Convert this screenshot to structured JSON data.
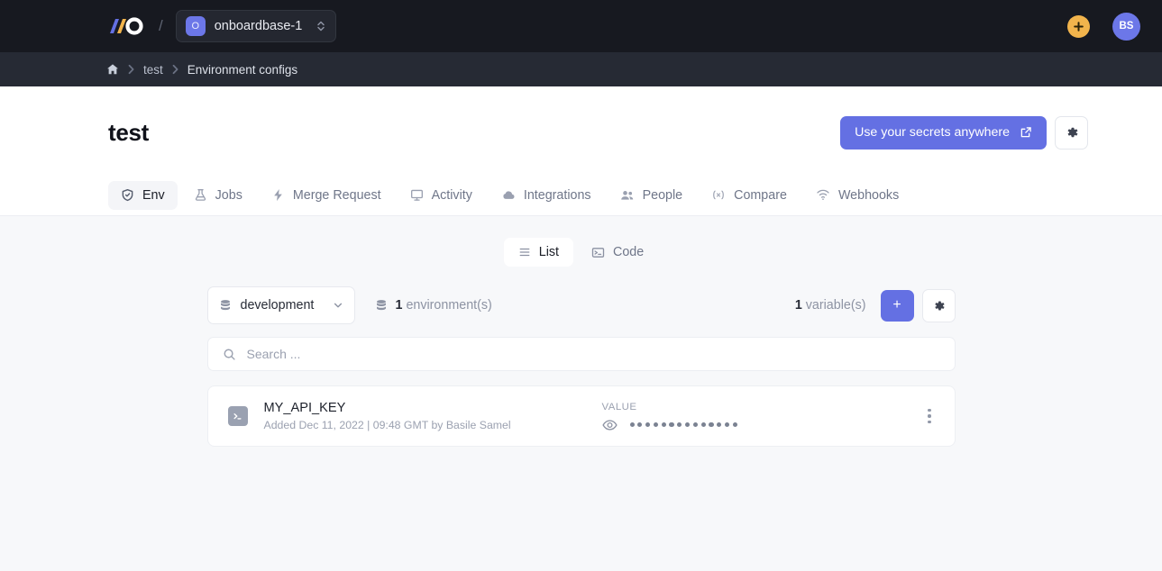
{
  "topbar": {
    "logo_name": "onboardbase-logo",
    "divider": "/",
    "org": {
      "avatar_initial": "O",
      "name": "onboardbase-1"
    },
    "add_button_label": "+",
    "user_initials": "BS",
    "accent_purple": "#6470e3",
    "accent_orange": "#f2b44c",
    "bar_bg": "#171920"
  },
  "breadcrumb": {
    "home_label": "home",
    "items": [
      "test",
      "Environment configs"
    ],
    "separator": "›",
    "bar_bg": "#262a34"
  },
  "header": {
    "title": "test",
    "primary_button": "Use your secrets anywhere",
    "settings_icon": "gear-icon"
  },
  "tabs": [
    {
      "label": "Env",
      "icon": "shield-icon",
      "active": true
    },
    {
      "label": "Jobs",
      "icon": "flask-icon",
      "active": false
    },
    {
      "label": "Merge Request",
      "icon": "lightning-icon",
      "active": false
    },
    {
      "label": "Activity",
      "icon": "monitor-icon",
      "active": false
    },
    {
      "label": "Integrations",
      "icon": "cloud-icon",
      "active": false
    },
    {
      "label": "People",
      "icon": "users-icon",
      "active": false
    },
    {
      "label": "Compare",
      "icon": "code-brackets-icon",
      "active": false
    },
    {
      "label": "Webhooks",
      "icon": "broadcast-icon",
      "active": false
    }
  ],
  "view_toggle": [
    {
      "label": "List",
      "icon": "list-icon",
      "active": true
    },
    {
      "label": "Code",
      "icon": "terminal-icon",
      "active": false
    }
  ],
  "controls": {
    "environment_selected": "development",
    "environment_count_number": "1",
    "environment_count_label": "environment(s)",
    "variable_count_number": "1",
    "variable_count_label": "variable(s)",
    "add_button_label": "+",
    "settings_icon": "gear-icon"
  },
  "search": {
    "placeholder": "Search ...",
    "value": "",
    "icon": "search-icon"
  },
  "variables": [
    {
      "name": "MY_API_KEY",
      "meta": "Added Dec 11, 2022 | 09:48 GMT by Basile Samel",
      "value_label": "VALUE",
      "value_masked_dots": 14,
      "icon": "terminal-icon",
      "reveal_icon": "eye-icon",
      "menu_icon": "kebab-menu-icon"
    }
  ]
}
